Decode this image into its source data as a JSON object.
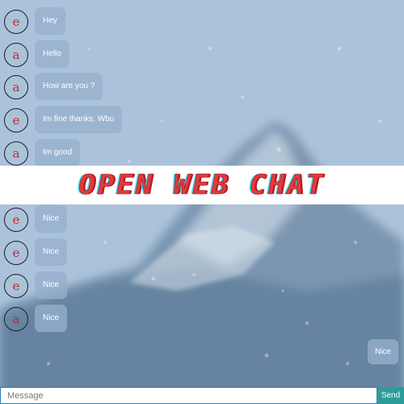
{
  "banner": {
    "title": "OPEN WEB CHAT"
  },
  "messages_top": [
    {
      "avatar": "e",
      "text": "Hey"
    },
    {
      "avatar": "a",
      "text": "Hello"
    },
    {
      "avatar": "a",
      "text": "How are you ?"
    },
    {
      "avatar": "e",
      "text": "Im fine thanks. Wbu"
    },
    {
      "avatar": "a",
      "text": "Im good"
    }
  ],
  "messages_bottom": [
    {
      "avatar": "e",
      "text": "Nice"
    },
    {
      "avatar": "e",
      "text": "Nice"
    },
    {
      "avatar": "e",
      "text": "Nice"
    },
    {
      "avatar": "a",
      "text": "Nice"
    }
  ],
  "own_message": {
    "text": "Nice"
  },
  "composer": {
    "placeholder": "Message",
    "send_label": "Send"
  },
  "colors": {
    "avatar_letter": "#c0272d",
    "banner_text": "#e23a3a",
    "send_button": "#2a9d9a"
  }
}
